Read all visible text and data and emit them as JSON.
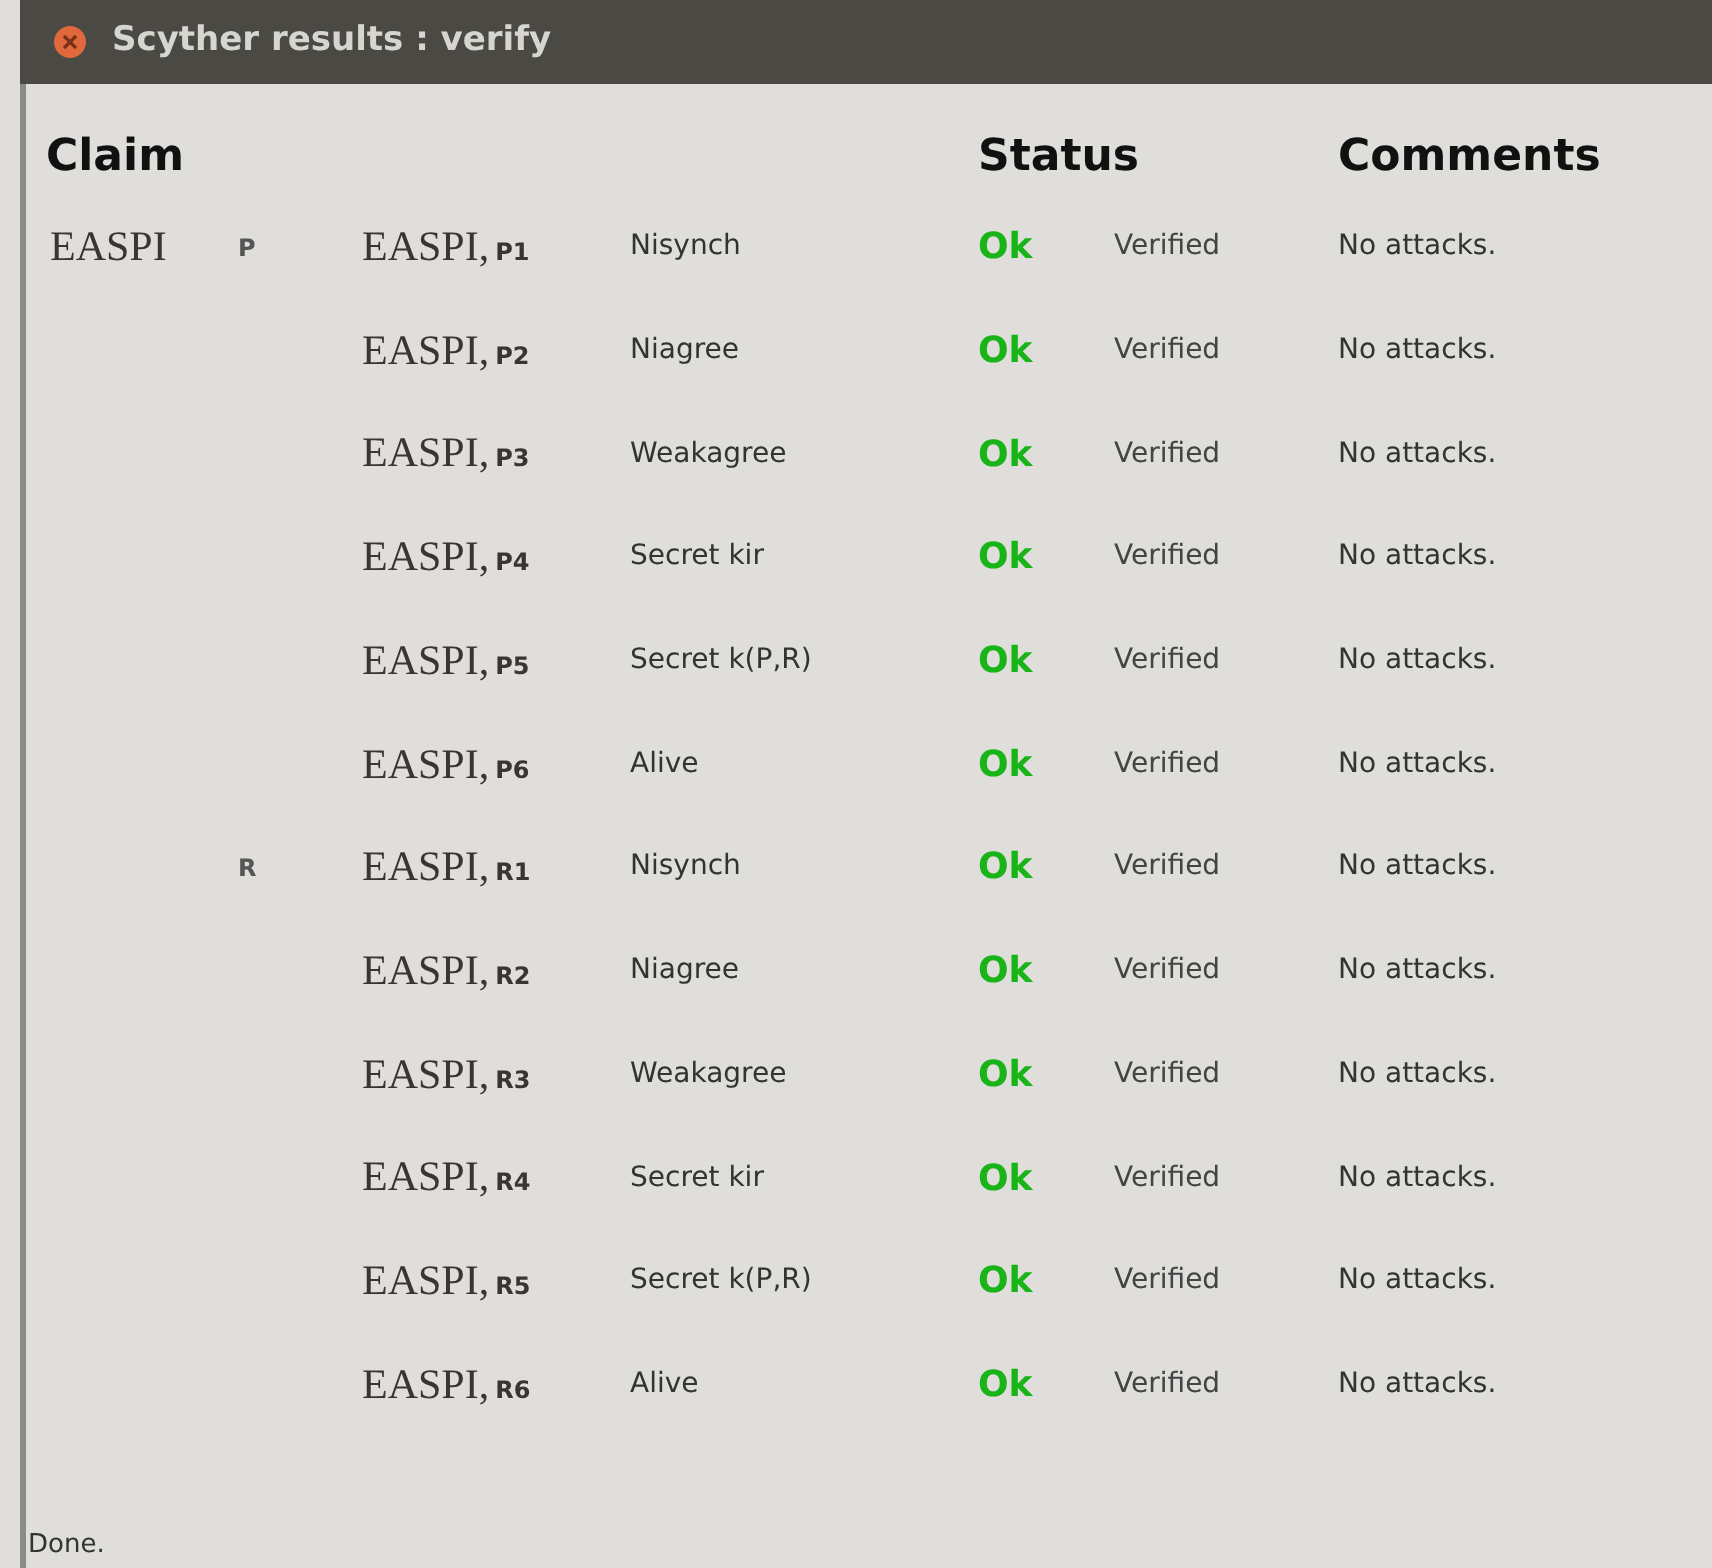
{
  "window": {
    "title": "Scyther results : verify"
  },
  "columns": [
    "Claim",
    "Status",
    "Comments"
  ],
  "rows": [
    {
      "protocol": "EASPI",
      "role": "P",
      "claim_prefix": "EASPI,",
      "claim_label": "P1",
      "claim_type": "Nisynch",
      "status": "Ok",
      "kind": "ok",
      "result": "Verified",
      "comment": "No attacks."
    },
    {
      "claim_prefix": "EASPI,",
      "claim_label": "P2",
      "claim_type": "Niagree",
      "status": "Ok",
      "kind": "ok",
      "result": "Verified",
      "comment": "No attacks."
    },
    {
      "claim_prefix": "EASPI,",
      "claim_label": "P3",
      "claim_type": "Weakagree",
      "status": "Ok",
      "kind": "ok",
      "result": "Verified",
      "comment": "No attacks."
    },
    {
      "claim_prefix": "EASPI,",
      "claim_label": "P4",
      "claim_type": "Secret kir",
      "status": "Ok",
      "kind": "ok",
      "result": "Verified",
      "comment": "No attacks."
    },
    {
      "claim_prefix": "EASPI,",
      "claim_label": "P5",
      "claim_type": "Secret k(P,R)",
      "status": "Ok",
      "kind": "ok",
      "result": "Verified",
      "comment": "No attacks."
    },
    {
      "claim_prefix": "EASPI,",
      "claim_label": "P6",
      "claim_type": "Alive",
      "status": "Ok",
      "kind": "ok",
      "result": "Verified",
      "comment": "No attacks."
    },
    {
      "role": "R",
      "claim_prefix": "EASPI,",
      "claim_label": "R1",
      "claim_type": "Nisynch",
      "status": "Ok",
      "kind": "ok",
      "result": "Verified",
      "comment": "No attacks."
    },
    {
      "claim_prefix": "EASPI,",
      "claim_label": "R2",
      "claim_type": "Niagree",
      "status": "Ok",
      "kind": "ok",
      "result": "Verified",
      "comment": "No attacks."
    },
    {
      "claim_prefix": "EASPI,",
      "claim_label": "R3",
      "claim_type": "Weakagree",
      "status": "Ok",
      "kind": "ok",
      "result": "Verified",
      "comment": "No attacks."
    },
    {
      "claim_prefix": "EASPI,",
      "claim_label": "R4",
      "claim_type": "Secret kir",
      "status": "Ok",
      "kind": "ok",
      "result": "Verified",
      "comment": "No attacks."
    },
    {
      "claim_prefix": "EASPI,",
      "claim_label": "R5",
      "claim_type": "Secret k(P,R)",
      "status": "Ok",
      "kind": "ok",
      "result": "Verified",
      "comment": "No attacks."
    },
    {
      "claim_prefix": "EASPI,",
      "claim_label": "R6",
      "claim_type": "Alive",
      "status": "Ok",
      "kind": "ok",
      "result": "Verified",
      "comment": "No attacks."
    }
  ],
  "status_bar": "Done."
}
